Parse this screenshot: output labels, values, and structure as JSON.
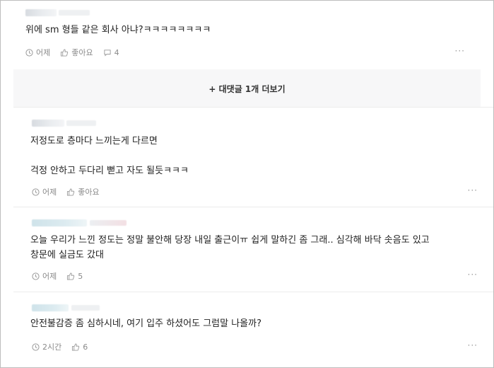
{
  "comments": [
    {
      "text": "위에 sm 형들 같은 회사 아냐?ㅋㅋㅋㅋㅋㅋㅋㅋ",
      "time": "어제",
      "like_label": "좋아요",
      "reply_count": "4",
      "more": "···"
    },
    {
      "text": "저정도로 층마다 느끼는게 다르면\n\n걱정 안하고 두다리 뻗고 자도 될듯ㅋㅋㅋ",
      "time": "어제",
      "like_label": "좋아요",
      "more": "···"
    },
    {
      "text": "오늘 우리가 느낀 정도는 정말 불안해 당장 내일 출근이ㅠ 쉽게 말하긴 좀 그래.. 심각해 바닥 솟음도 있고\n창문에 실금도 갔대",
      "time": "어제",
      "like_count": "5",
      "more": "···"
    },
    {
      "text": "안전불감증 좀 심하시네, 여기 입주 하셨어도 그럼말 나올까?",
      "time": "2시간",
      "like_count": "6",
      "more": "···"
    }
  ],
  "more_replies_label": "+ 대댓글 1개 더보기",
  "colors": {
    "meta_text": "#8a8a8a",
    "reply_box_bg": "#f7f7f8",
    "divider": "#ececec"
  },
  "icons": {
    "time": "clock-icon",
    "like": "thumbs-up-icon",
    "reply": "speech-bubble-icon",
    "more": "more-dots-icon"
  }
}
